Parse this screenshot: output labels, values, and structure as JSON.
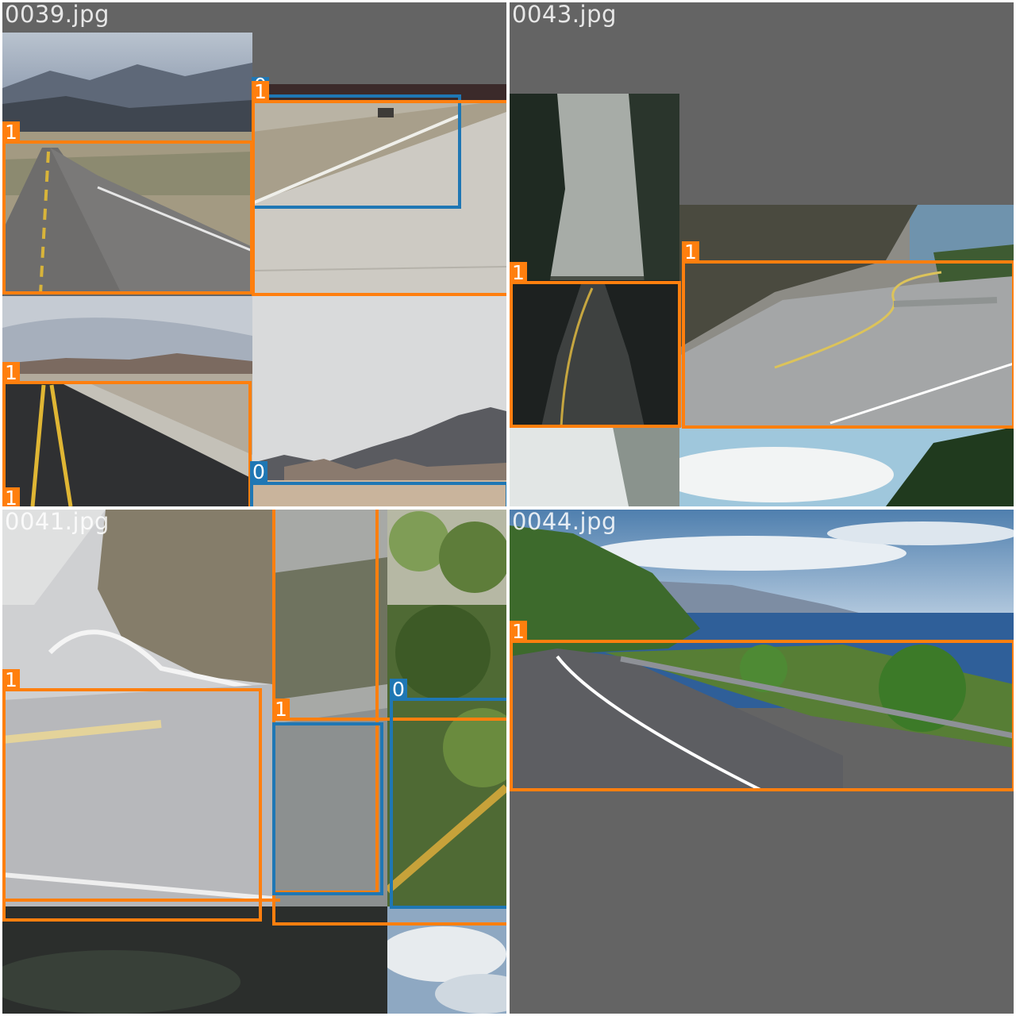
{
  "tiles": [
    {
      "filename": "0039.jpg"
    },
    {
      "filename": "0043.jpg"
    },
    {
      "filename": "0041.jpg"
    },
    {
      "filename": "0044.jpg"
    }
  ],
  "class_colors": {
    "0": "#1f77b4",
    "1": "#ff7f0e"
  },
  "labels": {
    "road": "1",
    "other": "0"
  }
}
